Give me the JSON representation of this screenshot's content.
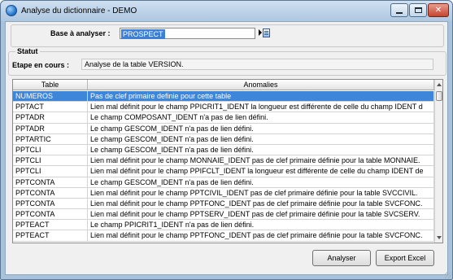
{
  "window": {
    "title": "Analyse du dictionnaire - DEMO"
  },
  "base": {
    "label": "Base à analyser :",
    "value": "PROSPECT"
  },
  "statut": {
    "title": "Statut",
    "etape_label": "Etape en cours :",
    "etape_value": "Analyse de la table VERSION."
  },
  "grid": {
    "columns": [
      "Table",
      "Anomalies"
    ],
    "rows": [
      {
        "table": "NUMEROS",
        "anomalie": "Pas de clef primaire definie pour cette table",
        "selected": true
      },
      {
        "table": "PPTACT",
        "anomalie": "Lien mal définit pour le champ PPICRIT1_IDENT la longueur est différente de celle du champ IDENT d"
      },
      {
        "table": "PPTADR",
        "anomalie": "Le champ COMPOSANT_IDENT n'a pas de lien défini."
      },
      {
        "table": "PPTADR",
        "anomalie": "Le champ GESCOM_IDENT n'a pas de lien défini."
      },
      {
        "table": "PPTARTIC",
        "anomalie": "Le champ GESCOM_IDENT n'a pas de lien défini."
      },
      {
        "table": "PPTCLI",
        "anomalie": "Le champ GESCOM_IDENT n'a pas de lien défini."
      },
      {
        "table": "PPTCLI",
        "anomalie": "Lien mal définit pour le champ MONNAIE_IDENT pas de clef primaire définie pour la table MONNAIE."
      },
      {
        "table": "PPTCLI",
        "anomalie": "Lien mal définit pour le champ PPIFCLT_IDENT la longueur est différente de celle du champ IDENT de"
      },
      {
        "table": "PPTCONTA",
        "anomalie": "Le champ GESCOM_IDENT n'a pas de lien défini."
      },
      {
        "table": "PPTCONTA",
        "anomalie": "Lien mal définit pour le champ PPTCIVIL_IDENT pas de clef primaire définie pour la table SVCCIVIL."
      },
      {
        "table": "PPTCONTA",
        "anomalie": "Lien mal définit pour le champ PPTFONC_IDENT pas de clef primaire définie pour la table SVCFONC."
      },
      {
        "table": "PPTCONTA",
        "anomalie": "Lien mal définit pour le champ PPTSERV_IDENT pas de clef primaire définie pour la table SVCSERV."
      },
      {
        "table": "PPTEACT",
        "anomalie": "Le champ PPICRIT1_IDENT n'a pas de lien défini."
      },
      {
        "table": "PPTEACT",
        "anomalie": "Lien mal définit pour le champ PPTFONC_IDENT pas de clef primaire définie pour la table SVCFONC."
      }
    ]
  },
  "buttons": {
    "analyser": "Analyser",
    "export": "Export Excel"
  }
}
